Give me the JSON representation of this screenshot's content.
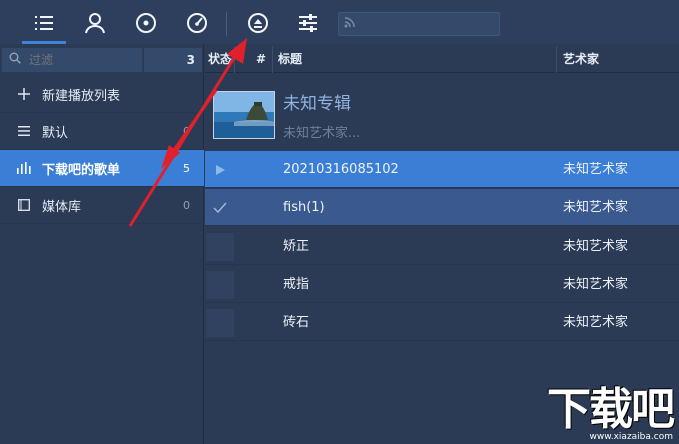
{
  "toolbar": {
    "buttons": [
      {
        "icon": "list-icon",
        "active": true
      },
      {
        "icon": "user-icon"
      },
      {
        "icon": "disc-icon"
      },
      {
        "icon": "gauge-icon"
      },
      {
        "icon": "eject-icon"
      },
      {
        "icon": "equalizer-icon"
      }
    ],
    "search": {
      "icon": "rss-icon",
      "value": "",
      "placeholder": ""
    }
  },
  "sidebar": {
    "filter": {
      "placeholder": "过滤",
      "count": "3"
    },
    "items": [
      {
        "icon": "plus-icon",
        "label": "新建播放列表",
        "count": ""
      },
      {
        "icon": "list-lines-icon",
        "label": "默认",
        "count": "0"
      },
      {
        "icon": "bars-icon",
        "label": "下载吧的歌单",
        "count": "5",
        "selected": true
      },
      {
        "icon": "library-icon",
        "label": "媒体库",
        "count": "0"
      }
    ]
  },
  "table": {
    "columns": {
      "status": "状态",
      "number": "#",
      "title": "标题",
      "artist": "艺术家"
    },
    "album": {
      "title": "未知专辑",
      "artist": "未知艺术家..."
    },
    "tracks": [
      {
        "status": "play-icon",
        "title": "20210316085102",
        "artist": "未知艺术家"
      },
      {
        "status": "check-icon",
        "title": "fish(1)",
        "artist": "未知艺术家"
      },
      {
        "status": "",
        "title": "矫正",
        "artist": "未知艺术家"
      },
      {
        "status": "",
        "title": "戒指",
        "artist": "未知艺术家"
      },
      {
        "status": "",
        "title": "砖石",
        "artist": "未知艺术家"
      }
    ]
  },
  "watermark": {
    "logo": "下载吧",
    "url": "www.xiazaiba.com"
  },
  "colors": {
    "accent": "#3a7fd5",
    "background": "#2b3b55",
    "arrow": "#e0202a"
  }
}
